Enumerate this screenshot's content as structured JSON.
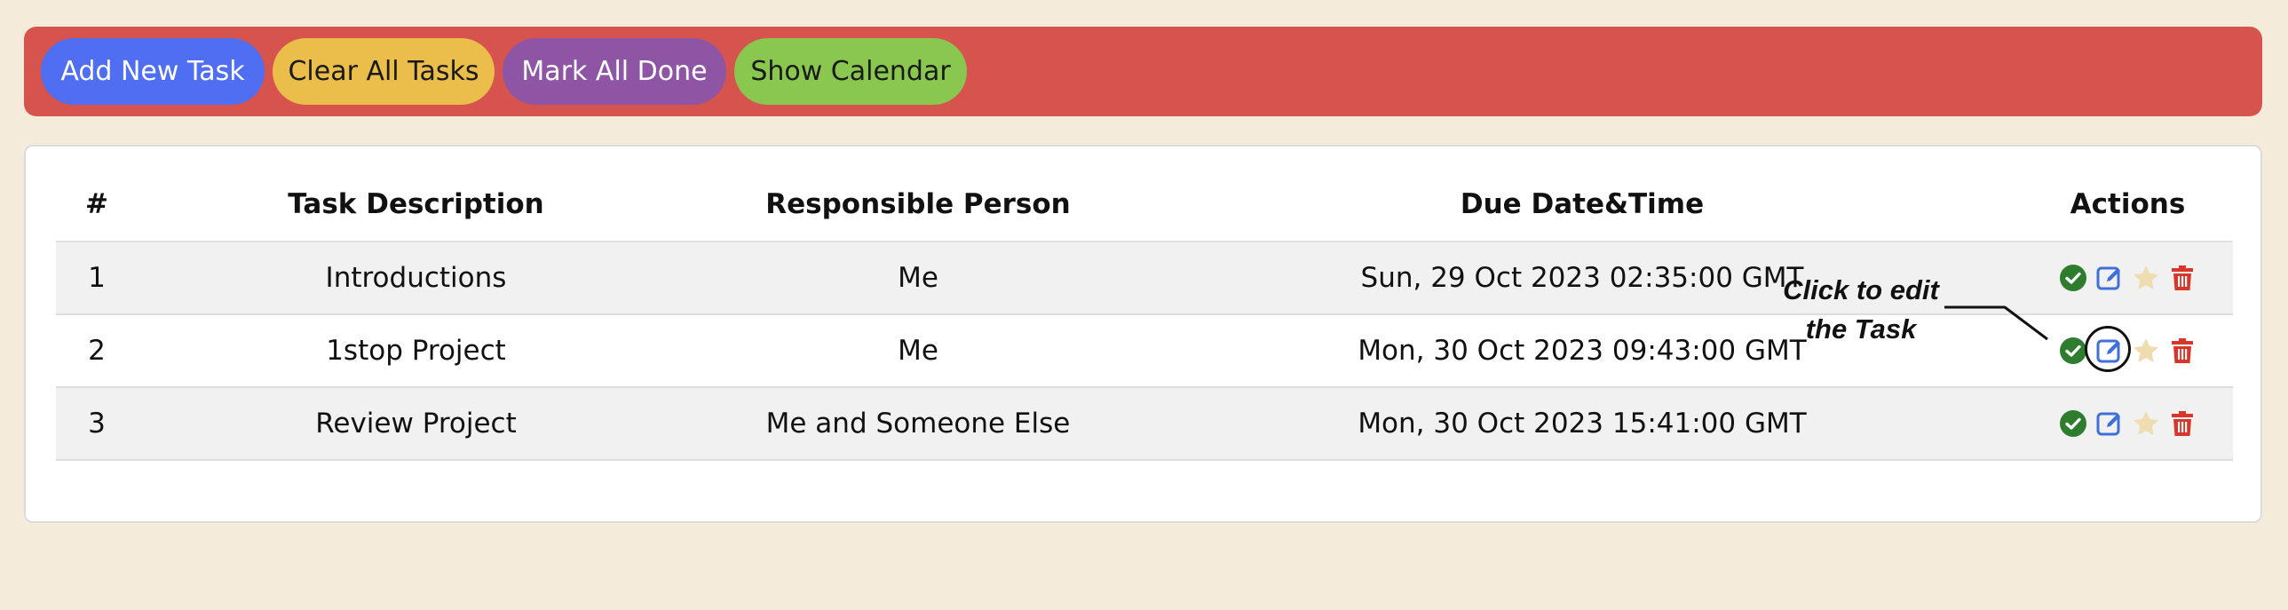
{
  "toolbar": {
    "add_label": "Add New Task",
    "clear_label": "Clear All Tasks",
    "done_label": "Mark All Done",
    "calendar_label": "Show Calendar"
  },
  "colors": {
    "page_background": "#f5ebda",
    "toolbar_background": "#d6534e",
    "add_button": "#4f6ef2",
    "clear_button": "#ebbd4a",
    "done_button": "#8e55a4",
    "calendar_button": "#8ac74f",
    "complete_icon": "#2e7d2e",
    "edit_icon": "#3f6fd8",
    "star_icon": "#efdcb0",
    "delete_icon": "#d9362b"
  },
  "table": {
    "headers": {
      "num": "#",
      "description": "Task Description",
      "person": "Responsible Person",
      "due": "Due Date&Time",
      "actions": "Actions"
    },
    "rows": [
      {
        "num": "1",
        "description": "Introductions",
        "person": "Me",
        "due": "Sun, 29 Oct 2023 02:35:00 GMT"
      },
      {
        "num": "2",
        "description": "1stop Project",
        "person": "Me",
        "due": "Mon, 30 Oct 2023 09:43:00 GMT"
      },
      {
        "num": "3",
        "description": "Review Project",
        "person": "Me and Someone Else",
        "due": "Mon, 30 Oct 2023 15:41:00 GMT"
      }
    ],
    "action_icons": [
      "check-circle-icon",
      "edit-icon",
      "star-icon",
      "trash-icon"
    ]
  },
  "annotation": {
    "line1": "Click to edit",
    "line2": "the Task"
  }
}
